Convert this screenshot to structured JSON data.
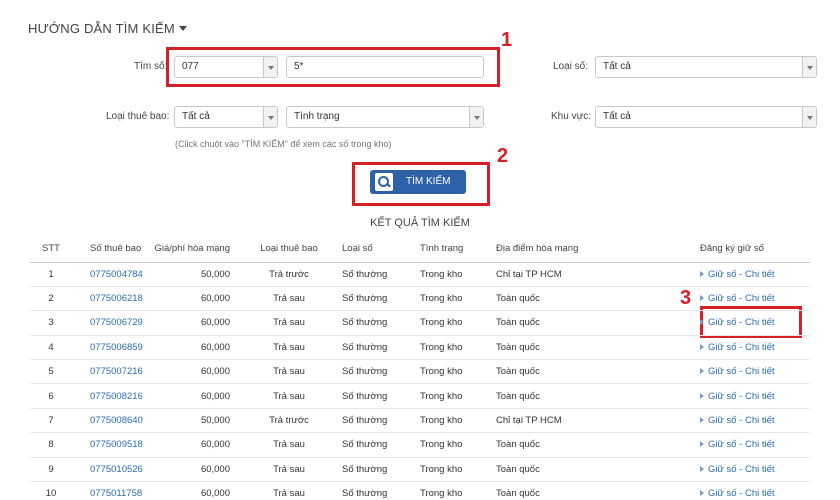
{
  "guide": {
    "label": "HƯỚNG DẪN TÌM KIẾM"
  },
  "form": {
    "tim_so_label": "Tìm số:",
    "prefix_value": "077",
    "number_value": "5*",
    "loai_so_label": "Loại số:",
    "loai_so_value": "Tất cả",
    "loai_thue_bao_label": "Loại thuê bao:",
    "loai_thue_bao_value": "Tất cả",
    "tinh_trang_value": "Tình trạng",
    "khu_vuc_label": "Khu vực:",
    "khu_vuc_value": "Tất cả",
    "hint": "(Click chuột vào \"TÌM KIẾM\" để xem các số trong kho)",
    "search_button": "TÌM KIẾM"
  },
  "annotations": {
    "n1": "1",
    "n2": "2",
    "n3": "3"
  },
  "colors": {
    "accent": "#2e62a8",
    "annotation": "#d42027",
    "link": "#2a6cb0"
  },
  "results": {
    "title": "KẾT QUẢ TÌM KIẾM",
    "headers": [
      "STT",
      "Số thuê bao",
      "Giá/phí hòa mạng",
      "Loại thuê bao",
      "Loại số",
      "Tình trạng",
      "Địa điểm hòa mạng",
      "Đăng ký giữ số"
    ],
    "rows": [
      [
        "1",
        "0775004784",
        "50,000",
        "Trả trước",
        "Số thường",
        "Trong kho",
        "Chỉ tại TP HCM",
        "Giữ số - Chi tiết"
      ],
      [
        "2",
        "0775006218",
        "60,000",
        "Trả sau",
        "Số thường",
        "Trong kho",
        "Toàn quốc",
        "Giữ số - Chi tiết"
      ],
      [
        "3",
        "0775006729",
        "60,000",
        "Trả sau",
        "Số thường",
        "Trong kho",
        "Toàn quốc",
        "Giữ số - Chi tiết"
      ],
      [
        "4",
        "0775006859",
        "60,000",
        "Trả sau",
        "Số thường",
        "Trong kho",
        "Toàn quốc",
        "Giữ số - Chi tiết"
      ],
      [
        "5",
        "0775007216",
        "60,000",
        "Trả sau",
        "Số thường",
        "Trong kho",
        "Toàn quốc",
        "Giữ số - Chi tiết"
      ],
      [
        "6",
        "0775008216",
        "60,000",
        "Trả sau",
        "Số thường",
        "Trong kho",
        "Toàn quốc",
        "Giữ số - Chi tiết"
      ],
      [
        "7",
        "0775008640",
        "50,000",
        "Trả trước",
        "Số thường",
        "Trong kho",
        "Chỉ tại TP HCM",
        "Giữ số - Chi tiết"
      ],
      [
        "8",
        "0775009518",
        "60,000",
        "Trả sau",
        "Số thường",
        "Trong kho",
        "Toàn quốc",
        "Giữ số - Chi tiết"
      ],
      [
        "9",
        "0775010526",
        "60,000",
        "Trả sau",
        "Số thường",
        "Trong kho",
        "Toàn quốc",
        "Giữ số - Chi tiết"
      ],
      [
        "10",
        "0775011758",
        "60,000",
        "Trả sau",
        "Số thường",
        "Trong kho",
        "Toàn quốc",
        "Giữ số - Chi tiết"
      ]
    ]
  }
}
